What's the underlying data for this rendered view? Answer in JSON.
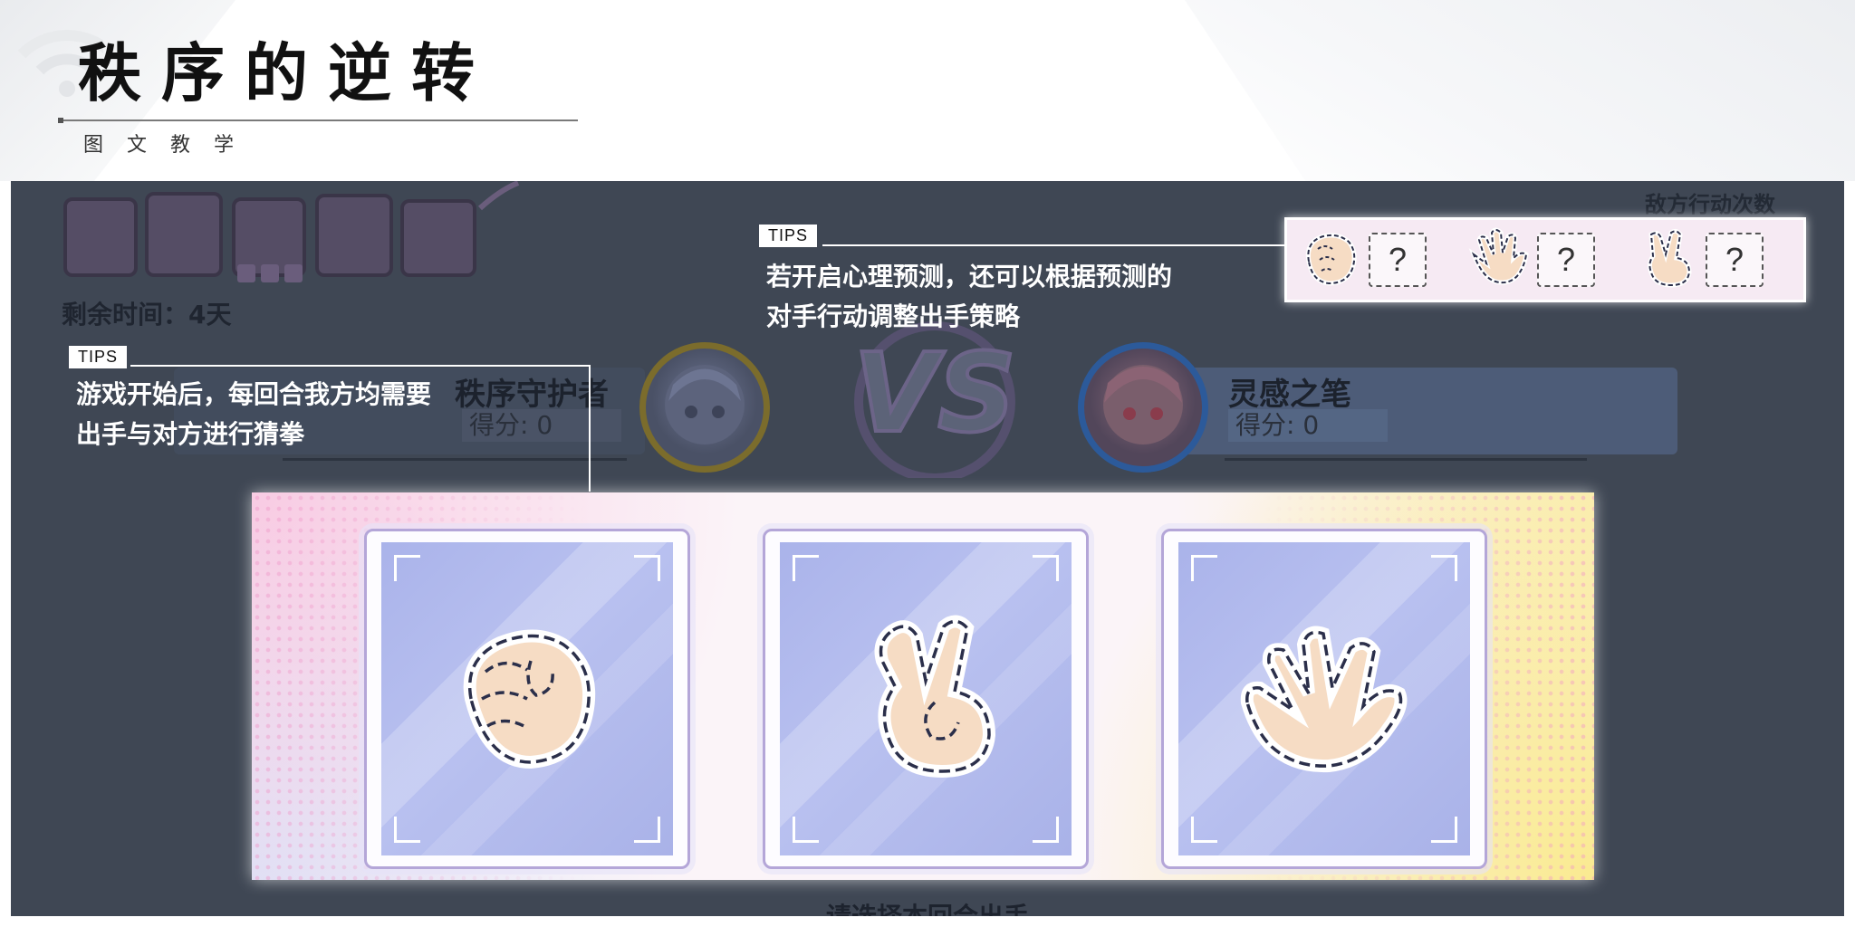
{
  "header": {
    "title": "秩序的逆转",
    "subtitle": "图文教学"
  },
  "game": {
    "remaining_time": "剩余时间：4天",
    "enemy_action_count_label": "敌方行动次数",
    "player_left": {
      "name": "秩序守护者",
      "score": "得分: 0"
    },
    "player_right": {
      "name": "灵感之笔",
      "score": "得分: 0"
    },
    "enemy_actions": [
      {
        "hand": "rock-icon",
        "value": "?"
      },
      {
        "hand": "paper-icon",
        "value": "?"
      },
      {
        "hand": "scissors-icon",
        "value": "?"
      }
    ],
    "choices": [
      {
        "hand": "rock-icon"
      },
      {
        "hand": "scissors-icon"
      },
      {
        "hand": "paper-icon"
      }
    ],
    "bottom_prompt": "请选择本回合出手"
  },
  "tips": [
    {
      "tag": "TIPS",
      "lines": [
        "游戏开始后，每回合我方均需要",
        "出手与对方进行猜拳"
      ]
    },
    {
      "tag": "TIPS",
      "lines": [
        "若开启心理预测，还可以根据预测的",
        "对手行动调整出手策略"
      ]
    }
  ],
  "colors": {
    "game_bg": "#3f4754",
    "card_border": "#b4a6d8",
    "card_fill": "#aab3ea",
    "hand_fill": "#f6dcc4",
    "hand_outline": "#2b2f4a"
  }
}
